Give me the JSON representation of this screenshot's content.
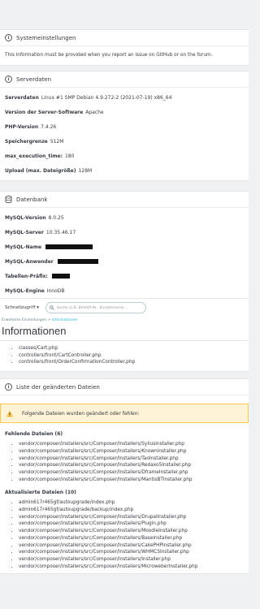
{
  "system": {
    "title": "Systemeinstellungen",
    "text": "This information must be provided when you report an issue on GitHub or on the forum."
  },
  "server": {
    "title": "Serverdaten",
    "rows": [
      {
        "label": "Serverdaten",
        "value": "Linux #1 SMP Debian 4.9.272-2 (2021-07-19) x86_64"
      },
      {
        "label": "Version der Server-Software",
        "value": "Apache"
      },
      {
        "label": "PHP-Version",
        "value": "7.4.26"
      },
      {
        "label": "Speichergrenze",
        "value": "512M"
      },
      {
        "label": "max_execution_time:",
        "value": "180"
      },
      {
        "label": "Upload (max. Dateigröße)",
        "value": "128M"
      }
    ]
  },
  "database": {
    "title": "Datenbank",
    "rows": [
      {
        "label": "MySQL-Version",
        "value": "8.0.25"
      },
      {
        "label": "MySQL-Server",
        "value": "10.35.46.17"
      },
      {
        "label": "MySQL-Name",
        "value": ""
      },
      {
        "label": "MySQL-Anwender",
        "value": ""
      },
      {
        "label": "Tabellen-Präfix:",
        "value": ""
      },
      {
        "label": "MySQL-Engine",
        "value": "InnoDB"
      }
    ]
  },
  "toolbar": {
    "quick_access": "Schnellzugriff ▾",
    "search_placeholder": "Suche (z.B. Bestell-Nr., Kundenname ..."
  },
  "breadcrumb": {
    "parent": "Erweiterte Einstellungen",
    "separator": ">",
    "current": "Informationen"
  },
  "page_title": "Informationen",
  "top_files": [
    "classes/Cart.php",
    "controllers/front/CartController.php",
    "controllers/front/OrderConfirmationController.php"
  ],
  "changed": {
    "title": "Liste der geänderten Dateien",
    "warning": "Folgende Dateien wurden geändert oder fehlen:",
    "missing_title": "Fehlende Dateien (6)",
    "missing": [
      "vendor/composer/installers/src/Composer/Installers/SyliusInstaller.php",
      "vendor/composer/installers/src/Composer/Installers/KnownInstaller.php",
      "vendor/composer/installers/src/Composer/Installers/TaoInstaller.php",
      "vendor/composer/installers/src/Composer/Installers/Redaxo5Installer.php",
      "vendor/composer/installers/src/Composer/Installers/DframeInstaller.php",
      "vendor/composer/installers/src/Composer/Installers/MantisBTInstaller.php"
    ],
    "updated_title": "Aktualisierte Dateien (10)",
    "updated": [
      "admin617r465gf/autoupgrade/index.php",
      "admin617r465gf/autoupgrade/backup/index.php",
      "vendor/composer/installers/src/Composer/Installers/DrupalInstaller.php",
      "vendor/composer/installers/src/Composer/Installers/Plugin.php",
      "vendor/composer/installers/src/Composer/Installers/MoodleInstaller.php",
      "vendor/composer/installers/src/Composer/Installers/BaseInstaller.php",
      "vendor/composer/installers/src/Composer/Installers/CakePHPInstaller.php",
      "vendor/composer/installers/src/Composer/Installers/WHMCSInstaller.php",
      "vendor/composer/installers/src/Composer/Installers/Installer.php",
      "vendor/composer/installers/src/Composer/Installers/MicroweberInstaller.php"
    ]
  }
}
